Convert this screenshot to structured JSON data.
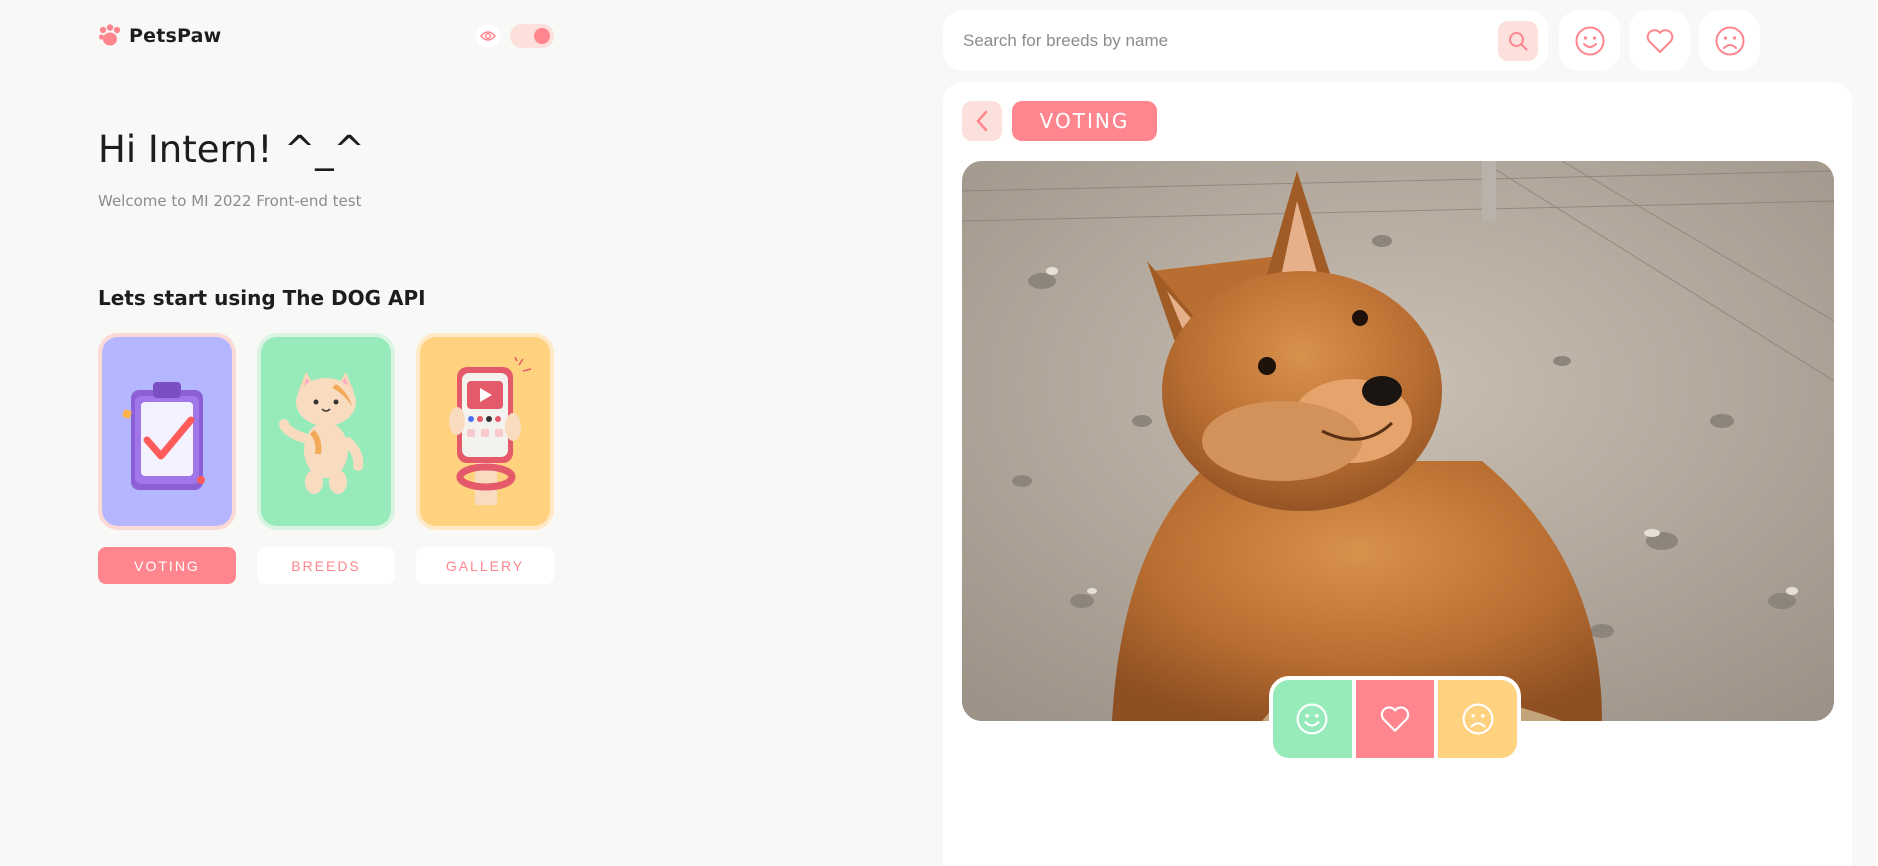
{
  "brand": {
    "name": "PetsPaw",
    "accent": "#ff868e"
  },
  "theme": {
    "icon": "eye-icon",
    "dark_mode": true
  },
  "greeting": {
    "title": "Hi Intern! ^_^",
    "subtitle": "Welcome to MI 2022 Front-end test"
  },
  "api_title": "Lets start using The DOG API",
  "cards": [
    {
      "label": "VOTING",
      "active": true,
      "bg": "#b4b7ff",
      "icon": "clipboard-check-illustration"
    },
    {
      "label": "BREEDS",
      "active": false,
      "bg": "#97eab9",
      "icon": "cat-illustration"
    },
    {
      "label": "GALLERY",
      "active": false,
      "bg": "#ffd280",
      "icon": "phone-gallery-illustration"
    }
  ],
  "search": {
    "placeholder": "Search for breeds by name",
    "value": "",
    "icon": "search-icon"
  },
  "nav_icons": [
    "smile-icon",
    "heart-icon",
    "sad-icon"
  ],
  "main": {
    "back_icon": "chevron-left-icon",
    "section": "VOTING",
    "photo": "red shiba inu puppy sitting on gravel",
    "vote_buttons": [
      {
        "action": "like",
        "icon": "smile-icon",
        "color": "#97eab9"
      },
      {
        "action": "favourite",
        "icon": "heart-icon",
        "color": "#ff868e"
      },
      {
        "action": "dislike",
        "icon": "sad-icon",
        "color": "#ffd280"
      }
    ]
  }
}
